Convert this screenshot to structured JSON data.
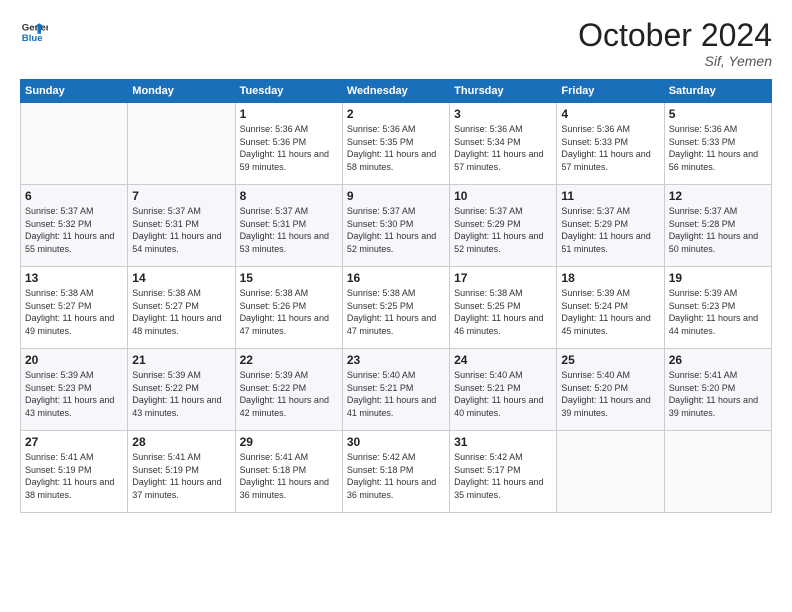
{
  "header": {
    "logo_line1": "General",
    "logo_line2": "Blue",
    "month": "October 2024",
    "location": "Sif, Yemen"
  },
  "weekdays": [
    "Sunday",
    "Monday",
    "Tuesday",
    "Wednesday",
    "Thursday",
    "Friday",
    "Saturday"
  ],
  "weeks": [
    [
      {
        "day": "",
        "sunrise": "",
        "sunset": "",
        "daylight": ""
      },
      {
        "day": "",
        "sunrise": "",
        "sunset": "",
        "daylight": ""
      },
      {
        "day": "1",
        "sunrise": "Sunrise: 5:36 AM",
        "sunset": "Sunset: 5:36 PM",
        "daylight": "Daylight: 11 hours and 59 minutes."
      },
      {
        "day": "2",
        "sunrise": "Sunrise: 5:36 AM",
        "sunset": "Sunset: 5:35 PM",
        "daylight": "Daylight: 11 hours and 58 minutes."
      },
      {
        "day": "3",
        "sunrise": "Sunrise: 5:36 AM",
        "sunset": "Sunset: 5:34 PM",
        "daylight": "Daylight: 11 hours and 57 minutes."
      },
      {
        "day": "4",
        "sunrise": "Sunrise: 5:36 AM",
        "sunset": "Sunset: 5:33 PM",
        "daylight": "Daylight: 11 hours and 57 minutes."
      },
      {
        "day": "5",
        "sunrise": "Sunrise: 5:36 AM",
        "sunset": "Sunset: 5:33 PM",
        "daylight": "Daylight: 11 hours and 56 minutes."
      }
    ],
    [
      {
        "day": "6",
        "sunrise": "Sunrise: 5:37 AM",
        "sunset": "Sunset: 5:32 PM",
        "daylight": "Daylight: 11 hours and 55 minutes."
      },
      {
        "day": "7",
        "sunrise": "Sunrise: 5:37 AM",
        "sunset": "Sunset: 5:31 PM",
        "daylight": "Daylight: 11 hours and 54 minutes."
      },
      {
        "day": "8",
        "sunrise": "Sunrise: 5:37 AM",
        "sunset": "Sunset: 5:31 PM",
        "daylight": "Daylight: 11 hours and 53 minutes."
      },
      {
        "day": "9",
        "sunrise": "Sunrise: 5:37 AM",
        "sunset": "Sunset: 5:30 PM",
        "daylight": "Daylight: 11 hours and 52 minutes."
      },
      {
        "day": "10",
        "sunrise": "Sunrise: 5:37 AM",
        "sunset": "Sunset: 5:29 PM",
        "daylight": "Daylight: 11 hours and 52 minutes."
      },
      {
        "day": "11",
        "sunrise": "Sunrise: 5:37 AM",
        "sunset": "Sunset: 5:29 PM",
        "daylight": "Daylight: 11 hours and 51 minutes."
      },
      {
        "day": "12",
        "sunrise": "Sunrise: 5:37 AM",
        "sunset": "Sunset: 5:28 PM",
        "daylight": "Daylight: 11 hours and 50 minutes."
      }
    ],
    [
      {
        "day": "13",
        "sunrise": "Sunrise: 5:38 AM",
        "sunset": "Sunset: 5:27 PM",
        "daylight": "Daylight: 11 hours and 49 minutes."
      },
      {
        "day": "14",
        "sunrise": "Sunrise: 5:38 AM",
        "sunset": "Sunset: 5:27 PM",
        "daylight": "Daylight: 11 hours and 48 minutes."
      },
      {
        "day": "15",
        "sunrise": "Sunrise: 5:38 AM",
        "sunset": "Sunset: 5:26 PM",
        "daylight": "Daylight: 11 hours and 47 minutes."
      },
      {
        "day": "16",
        "sunrise": "Sunrise: 5:38 AM",
        "sunset": "Sunset: 5:25 PM",
        "daylight": "Daylight: 11 hours and 47 minutes."
      },
      {
        "day": "17",
        "sunrise": "Sunrise: 5:38 AM",
        "sunset": "Sunset: 5:25 PM",
        "daylight": "Daylight: 11 hours and 46 minutes."
      },
      {
        "day": "18",
        "sunrise": "Sunrise: 5:39 AM",
        "sunset": "Sunset: 5:24 PM",
        "daylight": "Daylight: 11 hours and 45 minutes."
      },
      {
        "day": "19",
        "sunrise": "Sunrise: 5:39 AM",
        "sunset": "Sunset: 5:23 PM",
        "daylight": "Daylight: 11 hours and 44 minutes."
      }
    ],
    [
      {
        "day": "20",
        "sunrise": "Sunrise: 5:39 AM",
        "sunset": "Sunset: 5:23 PM",
        "daylight": "Daylight: 11 hours and 43 minutes."
      },
      {
        "day": "21",
        "sunrise": "Sunrise: 5:39 AM",
        "sunset": "Sunset: 5:22 PM",
        "daylight": "Daylight: 11 hours and 43 minutes."
      },
      {
        "day": "22",
        "sunrise": "Sunrise: 5:39 AM",
        "sunset": "Sunset: 5:22 PM",
        "daylight": "Daylight: 11 hours and 42 minutes."
      },
      {
        "day": "23",
        "sunrise": "Sunrise: 5:40 AM",
        "sunset": "Sunset: 5:21 PM",
        "daylight": "Daylight: 11 hours and 41 minutes."
      },
      {
        "day": "24",
        "sunrise": "Sunrise: 5:40 AM",
        "sunset": "Sunset: 5:21 PM",
        "daylight": "Daylight: 11 hours and 40 minutes."
      },
      {
        "day": "25",
        "sunrise": "Sunrise: 5:40 AM",
        "sunset": "Sunset: 5:20 PM",
        "daylight": "Daylight: 11 hours and 39 minutes."
      },
      {
        "day": "26",
        "sunrise": "Sunrise: 5:41 AM",
        "sunset": "Sunset: 5:20 PM",
        "daylight": "Daylight: 11 hours and 39 minutes."
      }
    ],
    [
      {
        "day": "27",
        "sunrise": "Sunrise: 5:41 AM",
        "sunset": "Sunset: 5:19 PM",
        "daylight": "Daylight: 11 hours and 38 minutes."
      },
      {
        "day": "28",
        "sunrise": "Sunrise: 5:41 AM",
        "sunset": "Sunset: 5:19 PM",
        "daylight": "Daylight: 11 hours and 37 minutes."
      },
      {
        "day": "29",
        "sunrise": "Sunrise: 5:41 AM",
        "sunset": "Sunset: 5:18 PM",
        "daylight": "Daylight: 11 hours and 36 minutes."
      },
      {
        "day": "30",
        "sunrise": "Sunrise: 5:42 AM",
        "sunset": "Sunset: 5:18 PM",
        "daylight": "Daylight: 11 hours and 36 minutes."
      },
      {
        "day": "31",
        "sunrise": "Sunrise: 5:42 AM",
        "sunset": "Sunset: 5:17 PM",
        "daylight": "Daylight: 11 hours and 35 minutes."
      },
      {
        "day": "",
        "sunrise": "",
        "sunset": "",
        "daylight": ""
      },
      {
        "day": "",
        "sunrise": "",
        "sunset": "",
        "daylight": ""
      }
    ]
  ]
}
